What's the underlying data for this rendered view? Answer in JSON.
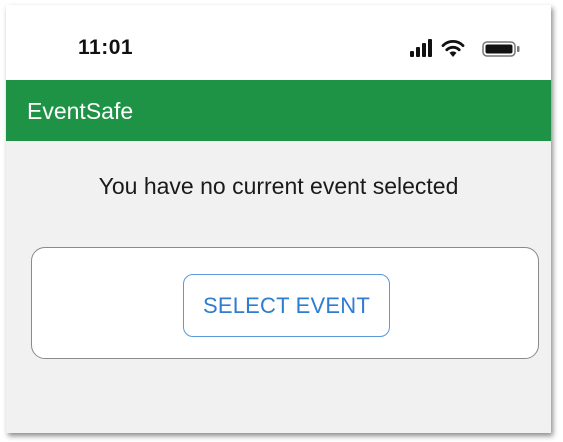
{
  "status_bar": {
    "time": "11:01",
    "icons": [
      "signal-icon",
      "wifi-icon",
      "battery-icon"
    ]
  },
  "app_bar": {
    "title": "EventSafe",
    "color": "#1e9346"
  },
  "main": {
    "empty_message": "You have no current event selected",
    "select_button_label": "SELECT EVENT",
    "button_color": "#2f7dd0"
  }
}
